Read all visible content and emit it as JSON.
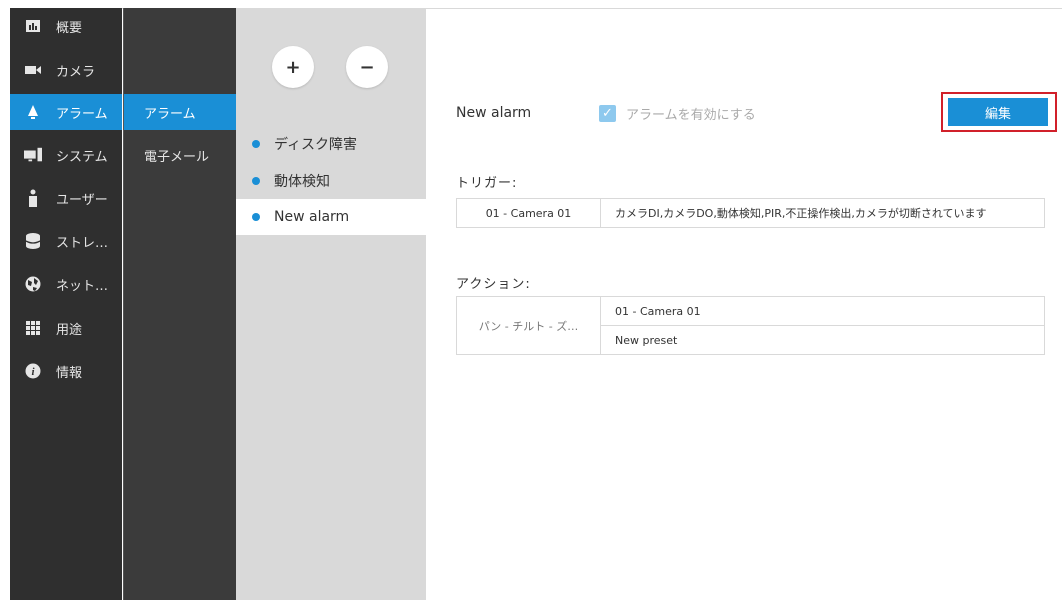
{
  "nav": {
    "items": [
      {
        "label": "概要",
        "icon": "chart-icon"
      },
      {
        "label": "カメラ",
        "icon": "camera-icon"
      },
      {
        "label": "アラーム",
        "icon": "bell-icon"
      },
      {
        "label": "システム",
        "icon": "computer-icon"
      },
      {
        "label": "ユーザー",
        "icon": "user-icon"
      },
      {
        "label": "ストレ…",
        "icon": "database-icon"
      },
      {
        "label": "ネット…",
        "icon": "globe-icon"
      },
      {
        "label": "用途",
        "icon": "grid-icon"
      },
      {
        "label": "情報",
        "icon": "info-icon"
      }
    ],
    "active_index": 2,
    "active_color": "#1a8fd6"
  },
  "subnav": {
    "items": [
      {
        "label": "アラーム"
      },
      {
        "label": "電子メール"
      }
    ]
  },
  "alarm_list": {
    "add_label": "+",
    "remove_label": "−",
    "items": [
      {
        "label": "ディスク障害"
      },
      {
        "label": "動体検知"
      },
      {
        "label": "New alarm"
      }
    ]
  },
  "detail": {
    "alarm_name": "New alarm",
    "enable_label": "アラームを有効にする",
    "enable_checked": true,
    "edit_label": "編集",
    "trigger_label": "トリガー:",
    "trigger_rows": [
      {
        "camera": "01 - Camera 01",
        "events": "カメラDI,カメラDO,動体検知,PIR,不正操作検出,カメラが切断されています"
      }
    ],
    "action_label": "アクション:",
    "action": {
      "type": "パン - チルト - ズ…",
      "camera": "01 - Camera 01",
      "preset": "New preset"
    }
  }
}
